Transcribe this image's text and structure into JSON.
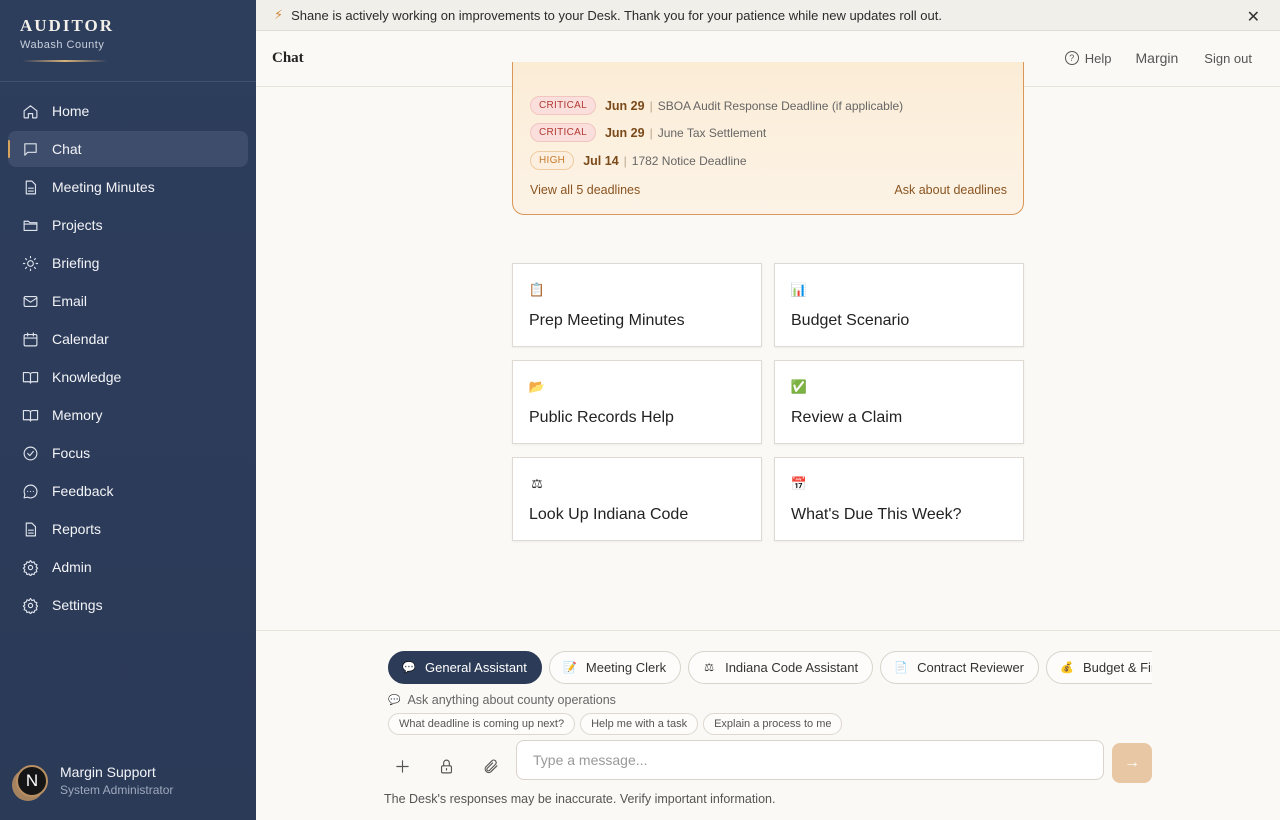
{
  "sidebar": {
    "brand_title": "AUDITOR",
    "brand_subtitle": "Wabash County",
    "items": [
      {
        "label": "Home",
        "icon": "home-icon"
      },
      {
        "label": "Chat",
        "icon": "chat-icon",
        "active": true
      },
      {
        "label": "Meeting Minutes",
        "icon": "document-icon"
      },
      {
        "label": "Projects",
        "icon": "folder-icon"
      },
      {
        "label": "Briefing",
        "icon": "sun-icon"
      },
      {
        "label": "Email",
        "icon": "mail-icon"
      },
      {
        "label": "Calendar",
        "icon": "calendar-icon"
      },
      {
        "label": "Knowledge",
        "icon": "book-icon"
      },
      {
        "label": "Memory",
        "icon": "book-icon"
      },
      {
        "label": "Focus",
        "icon": "check-circle-icon"
      },
      {
        "label": "Feedback",
        "icon": "message-dots-icon"
      },
      {
        "label": "Reports",
        "icon": "document-icon"
      },
      {
        "label": "Admin",
        "icon": "gear-icon"
      },
      {
        "label": "Settings",
        "icon": "gear-icon"
      }
    ],
    "user": {
      "initial": "N",
      "name": "Margin Support",
      "role": "System Administrator"
    }
  },
  "banner": {
    "text": "Shane is actively working on improvements to your Desk. Thank you for your patience while new updates roll out."
  },
  "header": {
    "title": "Chat",
    "help": "Help",
    "margin": "Margin",
    "sign_out": "Sign out"
  },
  "deadlines": {
    "items": [
      {
        "badge": "CRITICAL",
        "level": "critical",
        "date": "Jun 29",
        "title": "SBOA Audit Response Deadline (if applicable)"
      },
      {
        "badge": "CRITICAL",
        "level": "critical",
        "date": "Jun 29",
        "title": "June Tax Settlement"
      },
      {
        "badge": "HIGH",
        "level": "high",
        "date": "Jul 14",
        "title": "1782 Notice Deadline"
      }
    ],
    "view_all": "View all 5 deadlines",
    "ask": "Ask about deadlines",
    "separator": "|"
  },
  "quick_actions": [
    {
      "label": "Prep Meeting Minutes",
      "icon": "📋"
    },
    {
      "label": "Budget Scenario",
      "icon": "📊"
    },
    {
      "label": "Public Records Help",
      "icon": "📂"
    },
    {
      "label": "Review a Claim",
      "icon": "✅"
    },
    {
      "label": "Look Up Indiana Code",
      "icon": "⚖"
    },
    {
      "label": "What's Due This Week?",
      "icon": "📅"
    }
  ],
  "assistants": [
    {
      "label": "General Assistant",
      "icon": "💬",
      "active": true
    },
    {
      "label": "Meeting Clerk",
      "icon": "📝"
    },
    {
      "label": "Indiana Code Assistant",
      "icon": "⚖"
    },
    {
      "label": "Contract Reviewer",
      "icon": "📄"
    },
    {
      "label": "Budget & Fina",
      "icon": "💰"
    }
  ],
  "composer": {
    "hint": "Ask anything about county operations",
    "suggestions": [
      "What deadline is coming up next?",
      "Help me with a task",
      "Explain a process to me"
    ],
    "placeholder": "Type a message...",
    "disclaimer": "The Desk's responses may be inaccurate. Verify important information."
  }
}
